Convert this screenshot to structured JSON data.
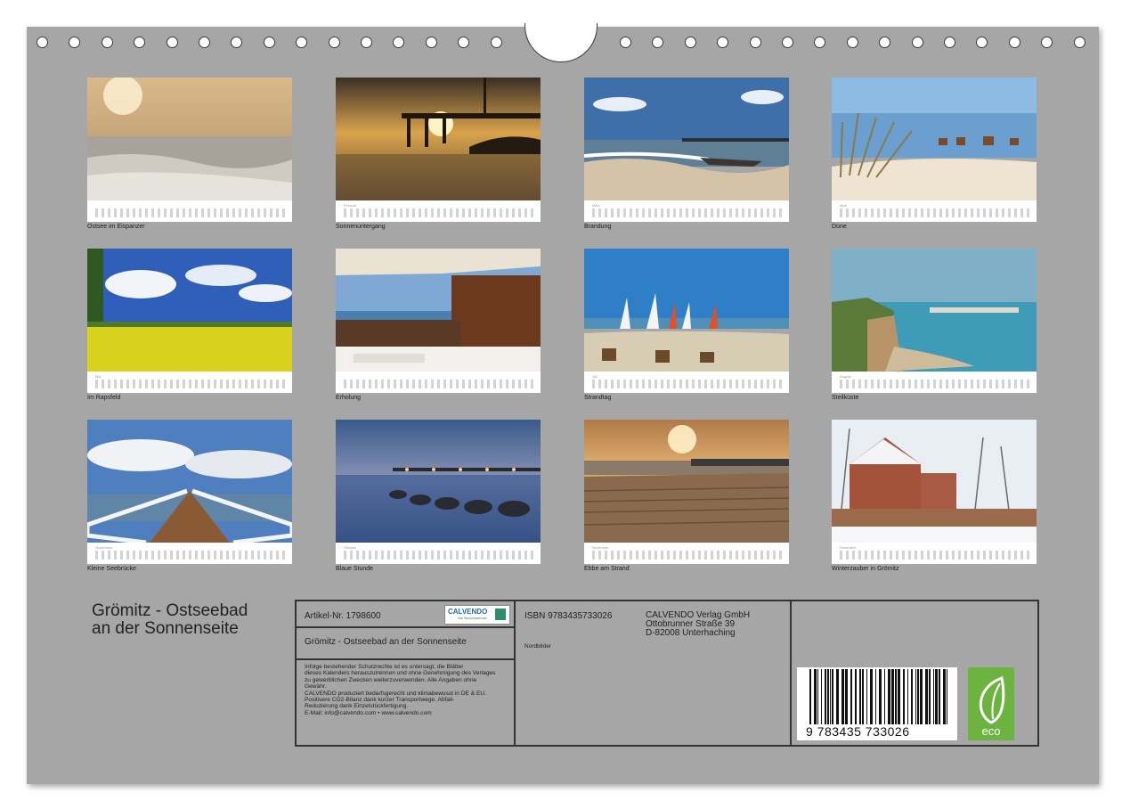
{
  "calendar": {
    "title_line1": "Grömitz - Ostseebad",
    "title_line2": "an der Sonnenseite"
  },
  "thumbnails": [
    {
      "caption": "Ostsee im Eispanzer",
      "month_label": ""
    },
    {
      "caption": "Sonnenuntergang",
      "month_label": "Februar"
    },
    {
      "caption": "Brandung",
      "month_label": "März"
    },
    {
      "caption": "Düne",
      "month_label": "April"
    },
    {
      "caption": "Im Rapsfeld",
      "month_label": "Mai"
    },
    {
      "caption": "Erholung",
      "month_label": ""
    },
    {
      "caption": "Strandtag",
      "month_label": "Juli"
    },
    {
      "caption": "Steilküste",
      "month_label": "August"
    },
    {
      "caption": "Kleine Seebrücke",
      "month_label": "September"
    },
    {
      "caption": "Blaue Stunde",
      "month_label": "Oktober"
    },
    {
      "caption": "Ebbe am Strand",
      "month_label": "November"
    },
    {
      "caption": "Winterzauber in Grömitz",
      "month_label": "Dezember"
    }
  ],
  "info": {
    "article": "Artikel-Nr. 1798600",
    "logo_text": "CALVENDO",
    "logo_sub": "Ihre Wunschkalender",
    "product_title": "Grömitz - Ostseebad an der Sonnenseite",
    "legal_lines": [
      "Infolge bestehender Schutzrechte ist es untersagt, die Blätter",
      "dieses Kalenders herauszutrennen und ohne Genehmigung des Verlages",
      "zu gewerblichen Zwecken weiterzuverwenden. Alle Angaben ohne",
      "Gewähr.",
      "CALVENDO produziert bedarfsgerecht und klimabewusst in DE & EU.",
      "Positivere CO2-Bilanz dank kurzer Transportwege. Abfall-",
      "Reduzierung dank Einzelstückfertigung.",
      "E-Mail: info@calvendo.com • www.calvendo.com"
    ],
    "isbn": "ISBN 9783435733026",
    "category": "Nordbilder",
    "publisher_line1": "CALVENDO Verlag GmbH",
    "publisher_line2": "Ottobrunner Straße 39",
    "publisher_line3": "D-82008 Unterhaching",
    "barcode_digits": "9 783435 733026",
    "eco_label": "eco"
  }
}
